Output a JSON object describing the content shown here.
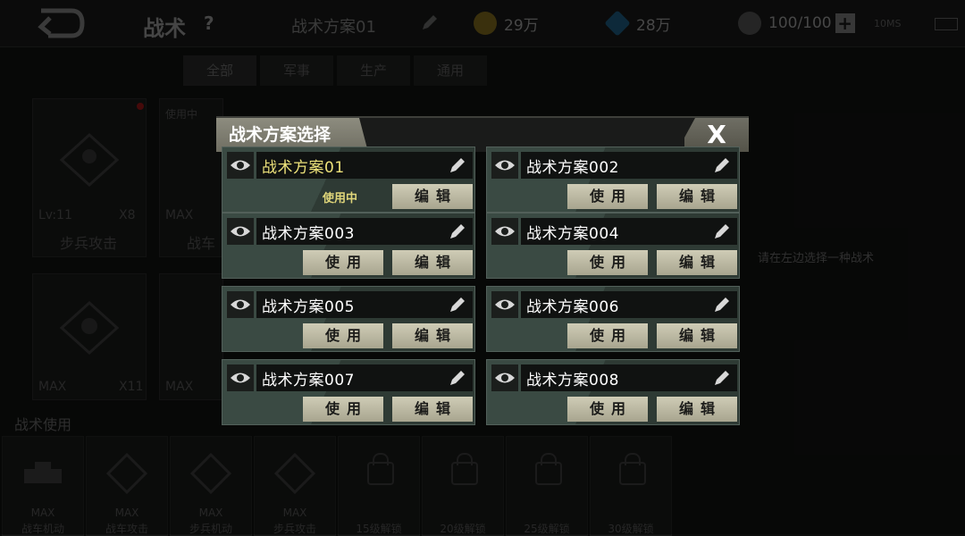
{
  "header": {
    "title": "战术",
    "help": "?",
    "current_plan": "战术方案01",
    "gold": "29万",
    "diamond": "28万",
    "energy": "100/100",
    "energy_plus": "+",
    "network": "10MS"
  },
  "tabs": [
    "全部",
    "军事",
    "生产",
    "通用"
  ],
  "background_cards": {
    "card1": {
      "level": "Lv:11",
      "count": "X8",
      "name": "步兵攻击"
    },
    "card2": {
      "status": "使用中",
      "level": "MAX",
      "name": "战车"
    },
    "card3": {
      "level": "MAX",
      "count": "X11"
    },
    "card4": {
      "level": "MAX"
    }
  },
  "hint": "请在左边选择一种战术",
  "section_title": "战术使用",
  "slots": [
    {
      "level": "MAX",
      "name": "战车机动"
    },
    {
      "level": "MAX",
      "name": "战车攻击"
    },
    {
      "level": "MAX",
      "name": "步兵机动"
    },
    {
      "level": "MAX",
      "name": "步兵攻击"
    },
    {
      "name": "15级解锁"
    },
    {
      "name": "20级解锁"
    },
    {
      "name": "25级解锁"
    },
    {
      "name": "30级解锁"
    }
  ],
  "modal": {
    "title": "战术方案选择",
    "close": "X",
    "in_use_label": "使用中",
    "use_label": "使用",
    "edit_label": "编辑",
    "plans": [
      {
        "name": "战术方案01",
        "active": true
      },
      {
        "name": "战术方案002",
        "active": false
      },
      {
        "name": "战术方案003",
        "active": false
      },
      {
        "name": "战术方案004",
        "active": false
      },
      {
        "name": "战术方案005",
        "active": false
      },
      {
        "name": "战术方案006",
        "active": false
      },
      {
        "name": "战术方案007",
        "active": false
      },
      {
        "name": "战术方案008",
        "active": false
      }
    ]
  },
  "colors": {
    "accent_gold": "#ede27a",
    "button": "#cfccb6",
    "panel": "#3a4a43"
  }
}
